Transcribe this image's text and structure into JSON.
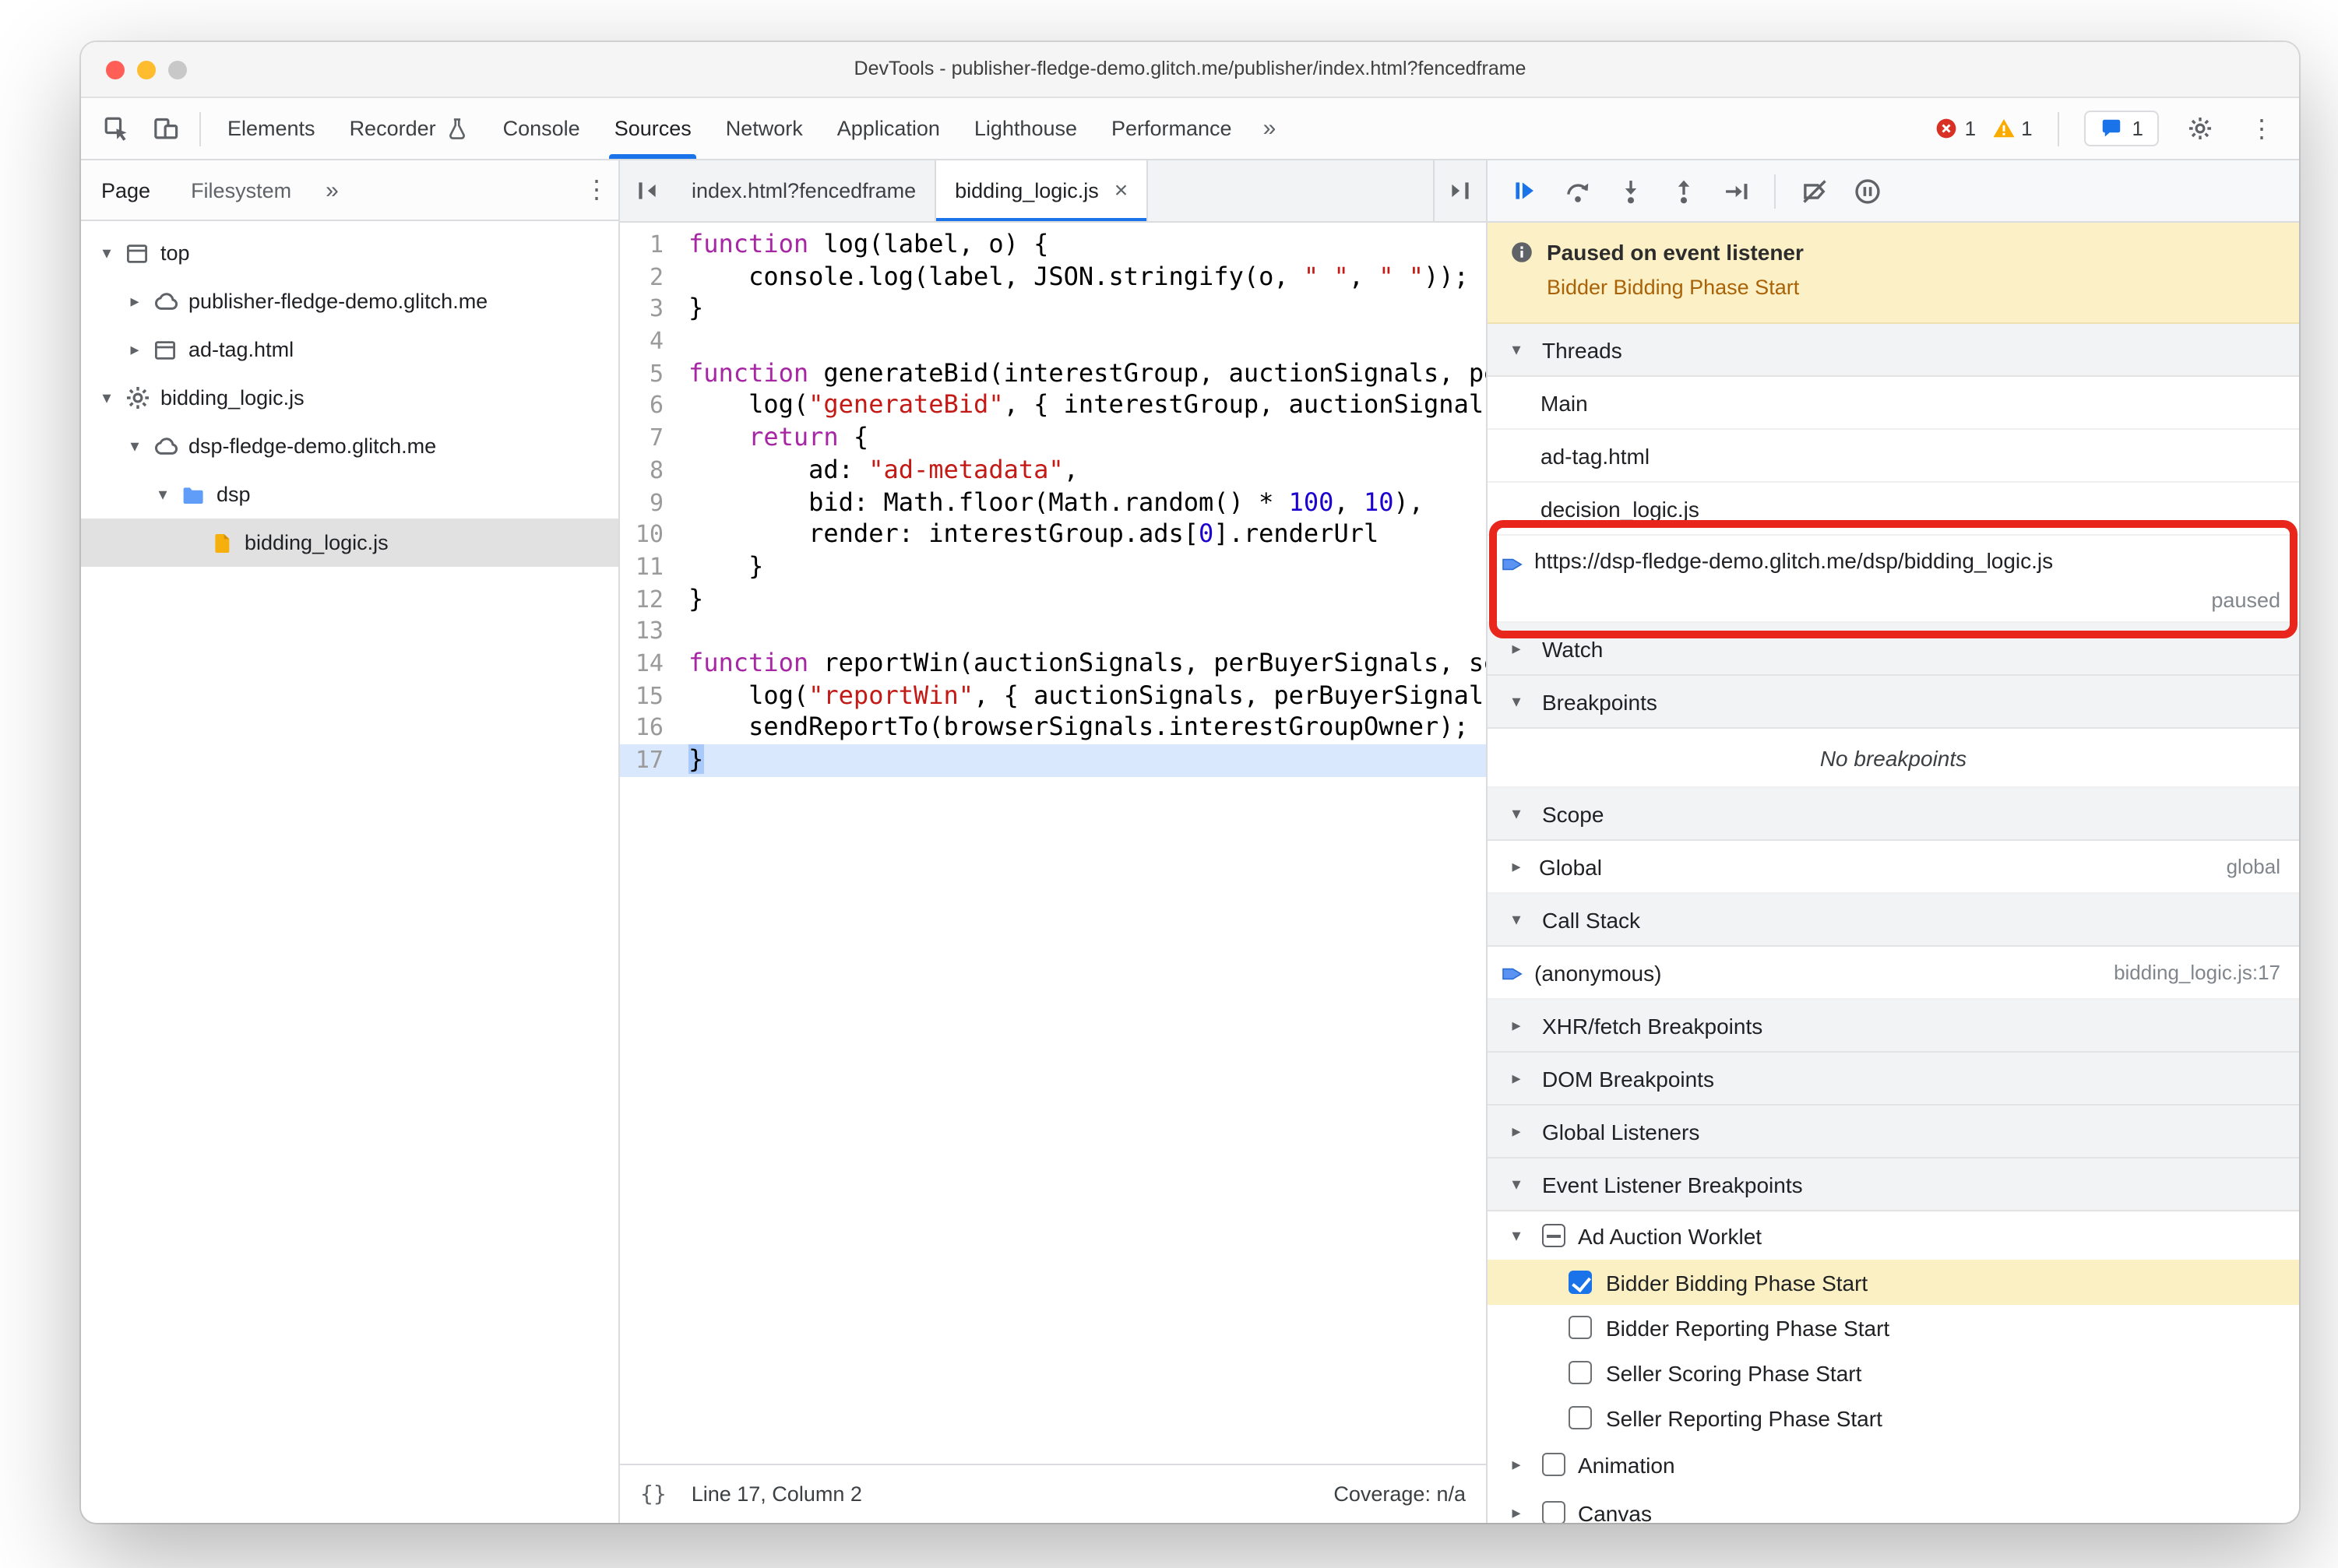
{
  "colors": {
    "accent": "#1a73e8",
    "annotation_red": "#e8261b",
    "paused_banner_bg": "#fcf1c6",
    "exec_line_bg": "#d9e8fd",
    "selected_row_bg": "#e1e1e1",
    "highlight_yellow": "#fbf0c3"
  },
  "window": {
    "title": "DevTools - publisher-fledge-demo.glitch.me/publisher/index.html?fencedframe"
  },
  "toolbar": {
    "left_icons": [
      "inspect-icon",
      "device-toolbar-icon"
    ],
    "panels": [
      "Elements",
      "Recorder",
      "Console",
      "Sources",
      "Network",
      "Application",
      "Lighthouse",
      "Performance"
    ],
    "active_panel": "Sources",
    "more_label": "»",
    "error_count": "1",
    "warning_count": "1",
    "issues_count": "1"
  },
  "sidebar": {
    "tabs": [
      "Page",
      "Filesystem"
    ],
    "active_tab": "Page",
    "more_label": "»",
    "tree": [
      {
        "label": "top",
        "icon": "frame-icon",
        "level": 0,
        "arrow": "expanded"
      },
      {
        "label": "publisher-fledge-demo.glitch.me",
        "icon": "cloud-icon",
        "level": 1,
        "arrow": "collapsed"
      },
      {
        "label": "ad-tag.html",
        "icon": "frame-icon",
        "level": 1,
        "arrow": "collapsed"
      },
      {
        "label": "bidding_logic.js",
        "icon": "worklet-gear-icon",
        "level": 0,
        "arrow": "expanded"
      },
      {
        "label": "dsp-fledge-demo.glitch.me",
        "icon": "cloud-icon",
        "level": 1,
        "arrow": "expanded"
      },
      {
        "label": "dsp",
        "icon": "folder-icon",
        "level": 2,
        "arrow": "expanded"
      },
      {
        "label": "bidding_logic.js",
        "icon": "js-file-icon",
        "level": 3,
        "arrow": "none",
        "selected": true
      }
    ]
  },
  "editor": {
    "tabs": [
      {
        "label": "index.html?fencedframe",
        "active": false,
        "closable": false
      },
      {
        "label": "bidding_logic.js",
        "active": true,
        "closable": true
      }
    ],
    "close_glyph": "×",
    "exec_line": 17,
    "lines": [
      [
        [
          "k",
          "function"
        ],
        [
          "p",
          " log(label, o) {"
        ]
      ],
      [
        [
          "p",
          "    console.log(label, JSON.stringify(o, "
        ],
        [
          "s",
          "\" \""
        ],
        [
          "p",
          ", "
        ],
        [
          "s",
          "\" \""
        ],
        [
          "p",
          "));"
        ]
      ],
      [
        [
          "p",
          "}"
        ]
      ],
      [],
      [
        [
          "k",
          "function"
        ],
        [
          "p",
          " generateBid(interestGroup, auctionSignals, perBuyerSignals, trustedBiddingSignals, browserSignals) {"
        ]
      ],
      [
        [
          "p",
          "    log("
        ],
        [
          "s",
          "\"generateBid\""
        ],
        [
          "p",
          ", { interestGroup, auctionSignals, perBuyerSignals, trustedBiddingSignals, browserSignals });"
        ]
      ],
      [
        [
          "p",
          "    "
        ],
        [
          "k",
          "return"
        ],
        [
          "p",
          " {"
        ]
      ],
      [
        [
          "p",
          "        ad: "
        ],
        [
          "s",
          "\"ad-metadata\""
        ],
        [
          "p",
          ","
        ]
      ],
      [
        [
          "p",
          "        bid: Math.floor(Math.random() * "
        ],
        [
          "n",
          "100"
        ],
        [
          "p",
          ", "
        ],
        [
          "n",
          "10"
        ],
        [
          "p",
          "),"
        ]
      ],
      [
        [
          "p",
          "        render: interestGroup.ads["
        ],
        [
          "n",
          "0"
        ],
        [
          "p",
          "].renderUrl"
        ]
      ],
      [
        [
          "p",
          "    }"
        ]
      ],
      [
        [
          "p",
          "}"
        ]
      ],
      [],
      [
        [
          "k",
          "function"
        ],
        [
          "p",
          " reportWin(auctionSignals, perBuyerSignals, sellerSignals, browserSignals) {"
        ]
      ],
      [
        [
          "p",
          "    log("
        ],
        [
          "s",
          "\"reportWin\""
        ],
        [
          "p",
          ", { auctionSignals, perBuyerSignals, sellerSignals, browserSignals });"
        ]
      ],
      [
        [
          "p",
          "    sendReportTo(browserSignals.interestGroupOwner);"
        ]
      ],
      [
        [
          "p",
          "}"
        ]
      ]
    ],
    "status": {
      "pretty_print": "{}",
      "line_col": "Line 17, Column 2",
      "coverage": "Coverage: n/a"
    }
  },
  "debugger": {
    "toolbar_icons": [
      "resume-icon",
      "step-over-icon",
      "step-into-icon",
      "step-out-icon",
      "step-icon",
      "divider",
      "deactivate-breakpoints-icon",
      "pause-on-exceptions-icon"
    ],
    "paused_title": "Paused on event listener",
    "paused_reason": "Bidder Bidding Phase Start",
    "threads": {
      "title": "Threads",
      "items": [
        {
          "label": "Main"
        },
        {
          "label": "ad-tag.html"
        },
        {
          "label": "decision_logic.js"
        },
        {
          "label": "https://dsp-fledge-demo.glitch.me/dsp/bidding_logic.js",
          "sub": "paused",
          "current": true
        }
      ]
    },
    "watch": {
      "title": "Watch"
    },
    "breakpoints": {
      "title": "Breakpoints",
      "empty": "No breakpoints"
    },
    "scope": {
      "title": "Scope",
      "rows": [
        {
          "label": "Global",
          "right": "global"
        }
      ]
    },
    "call_stack": {
      "title": "Call Stack",
      "rows": [
        {
          "label": "(anonymous)",
          "right": "bidding_logic.js:17",
          "current": true
        }
      ]
    },
    "xhr": {
      "title": "XHR/fetch Breakpoints"
    },
    "dom": {
      "title": "DOM Breakpoints"
    },
    "global_listeners": {
      "title": "Global Listeners"
    },
    "elb": {
      "title": "Event Listener Breakpoints",
      "groups": [
        {
          "label": "Ad Auction Worklet",
          "state": "indeterminate",
          "expanded": true,
          "children": [
            {
              "label": "Bidder Bidding Phase Start",
              "checked": true,
              "highlight": true
            },
            {
              "label": "Bidder Reporting Phase Start",
              "checked": false
            },
            {
              "label": "Seller Scoring Phase Start",
              "checked": false
            },
            {
              "label": "Seller Reporting Phase Start",
              "checked": false
            }
          ]
        },
        {
          "label": "Animation",
          "state": "unchecked",
          "expanded": false,
          "children": []
        },
        {
          "label": "Canvas",
          "state": "unchecked",
          "expanded": false,
          "children": []
        }
      ]
    }
  }
}
